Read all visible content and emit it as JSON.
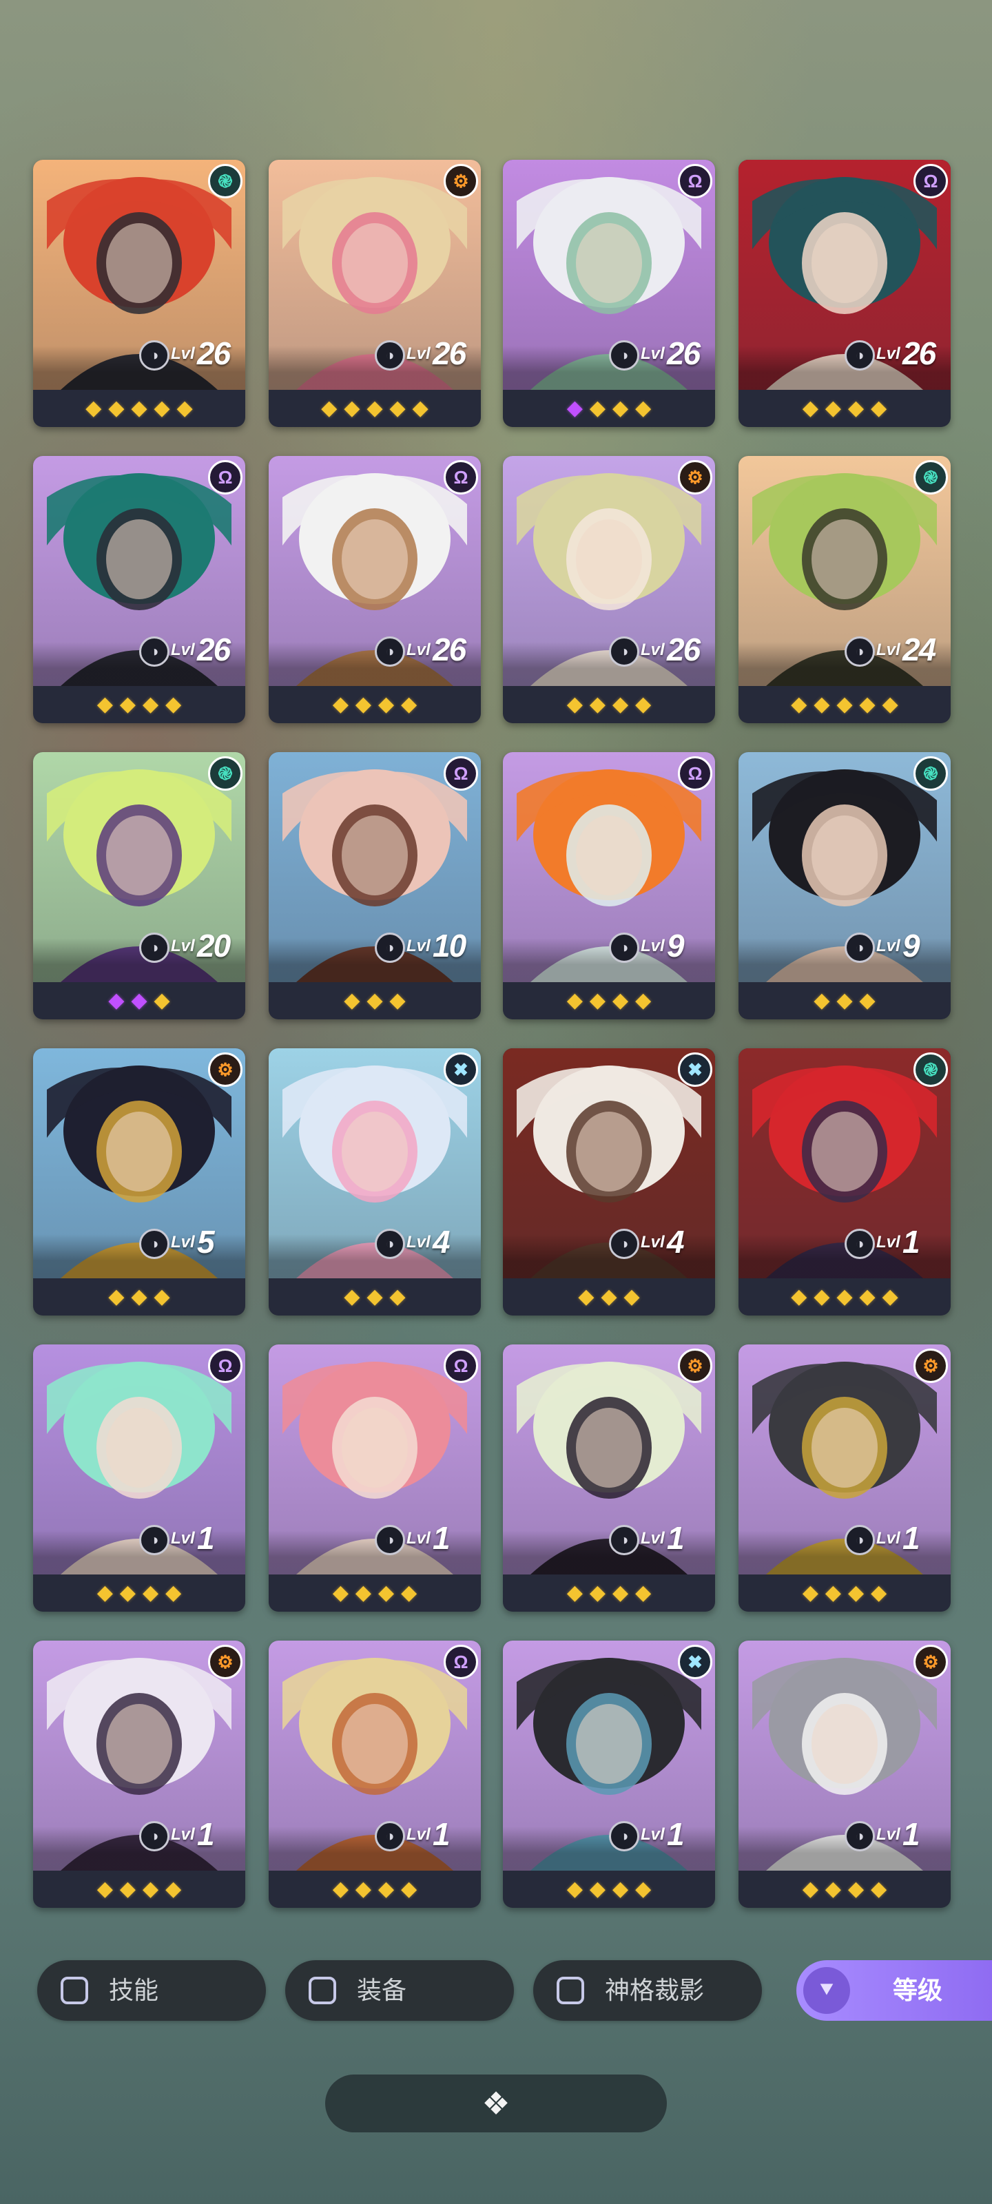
{
  "level_prefix": "Lvl",
  "heroes": [
    {
      "name": "hero-red-hair",
      "class_icon": "spiral-icon",
      "class_color": "teal",
      "level": "26",
      "stars": [
        "gold",
        "gold",
        "gold",
        "gold",
        "gold"
      ],
      "palette": [
        "#f4b37a",
        "#d9422c",
        "#2b2b33"
      ]
    },
    {
      "name": "hero-blonde-roses",
      "class_icon": "gear-icon",
      "class_color": "orange",
      "level": "26",
      "stars": [
        "gold",
        "gold",
        "gold",
        "gold",
        "gold"
      ],
      "palette": [
        "#f2bd9a",
        "#e8d2a4",
        "#e57a92"
      ]
    },
    {
      "name": "hero-white-hair",
      "class_icon": "omega-icon",
      "class_color": "purple",
      "level": "26",
      "stars": [
        "purple",
        "gold",
        "gold",
        "gold"
      ],
      "palette": [
        "#c28be2",
        "#ececf2",
        "#8dbfa5"
      ]
    },
    {
      "name": "hero-red-parasol",
      "class_icon": "omega-icon",
      "class_color": "purple",
      "level": "26",
      "stars": [
        "gold",
        "gold",
        "gold",
        "gold"
      ],
      "palette": [
        "#b5222e",
        "#23535a",
        "#f0d7c8"
      ]
    },
    {
      "name": "hero-teal-hood",
      "class_icon": "omega-icon",
      "class_color": "purple",
      "level": "26",
      "stars": [
        "gold",
        "gold",
        "gold",
        "gold"
      ],
      "palette": [
        "#c49be4",
        "#1d7a72",
        "#2a2a35"
      ]
    },
    {
      "name": "hero-curly-white",
      "class_icon": "omega-icon",
      "class_color": "purple",
      "level": "26",
      "stars": [
        "gold",
        "gold",
        "gold",
        "gold"
      ],
      "palette": [
        "#c49be4",
        "#f2f2f2",
        "#b07a4c"
      ]
    },
    {
      "name": "hero-green-bun",
      "class_icon": "gear-icon",
      "class_color": "orange",
      "level": "26",
      "stars": [
        "gold",
        "gold",
        "gold",
        "gold"
      ],
      "palette": [
        "#c4a4e8",
        "#d8d4a0",
        "#f4e6dc"
      ]
    },
    {
      "name": "hero-green-glow",
      "class_icon": "spiral-icon",
      "class_color": "teal",
      "level": "24",
      "stars": [
        "gold",
        "gold",
        "gold",
        "gold",
        "gold"
      ],
      "palette": [
        "#f2c79a",
        "#a7c85c",
        "#3a3a2a"
      ]
    },
    {
      "name": "hero-fox-ears",
      "class_icon": "spiral-icon",
      "class_color": "teal",
      "level": "20",
      "stars": [
        "purple",
        "purple",
        "gold"
      ],
      "palette": [
        "#b0d7a8",
        "#d4ec7c",
        "#5a3a7e"
      ]
    },
    {
      "name": "hero-golden-crown",
      "class_icon": "omega-icon",
      "class_color": "purple",
      "level": "10",
      "stars": [
        "gold",
        "gold",
        "gold"
      ],
      "palette": [
        "#7fb1d6",
        "#ecc4b8",
        "#6a3a2c"
      ]
    },
    {
      "name": "hero-orange-beanie",
      "class_icon": "omega-icon",
      "class_color": "purple",
      "level": "9",
      "stars": [
        "gold",
        "gold",
        "gold",
        "gold"
      ],
      "palette": [
        "#c49be4",
        "#f27b2a",
        "#dfefee"
      ]
    },
    {
      "name": "hero-black-hair",
      "class_icon": "spiral-icon",
      "class_color": "teal",
      "level": "9",
      "stars": [
        "gold",
        "gold",
        "gold"
      ],
      "palette": [
        "#8eb9d8",
        "#1c1c22",
        "#e6c8b4"
      ]
    },
    {
      "name": "hero-jackal",
      "class_icon": "gear-icon",
      "class_color": "orange",
      "level": "5",
      "stars": [
        "gold",
        "gold",
        "gold"
      ],
      "palette": [
        "#7fb7dc",
        "#1e1f30",
        "#d2a33a"
      ]
    },
    {
      "name": "hero-pastel-hair",
      "class_icon": "cross-icon",
      "class_color": "cyan",
      "level": "4",
      "stars": [
        "gold",
        "gold",
        "gold"
      ],
      "palette": [
        "#9dd2e6",
        "#dde8f6",
        "#f3a6c4"
      ]
    },
    {
      "name": "hero-white-headdress",
      "class_icon": "cross-icon",
      "class_color": "cyan",
      "level": "4",
      "stars": [
        "gold",
        "gold",
        "gold"
      ],
      "palette": [
        "#7a2a22",
        "#efe9e2",
        "#5a3a2c"
      ]
    },
    {
      "name": "hero-red-clown",
      "class_icon": "spiral-icon",
      "class_color": "teal",
      "level": "1",
      "stars": [
        "gold",
        "gold",
        "gold",
        "gold",
        "gold"
      ],
      "palette": [
        "#8c2a2a",
        "#d6262c",
        "#3a2a4a"
      ]
    },
    {
      "name": "hero-mint-hair",
      "class_icon": "omega-icon",
      "class_color": "purple",
      "level": "1",
      "stars": [
        "gold",
        "gold",
        "gold",
        "gold"
      ],
      "palette": [
        "#b690e0",
        "#8ee4cc",
        "#f2dcd2"
      ]
    },
    {
      "name": "hero-pink-hair",
      "class_icon": "omega-icon",
      "class_color": "purple",
      "level": "1",
      "stars": [
        "gold",
        "gold",
        "gold",
        "gold"
      ],
      "palette": [
        "#c49be4",
        "#ec8c9a",
        "#f4dcd2"
      ]
    },
    {
      "name": "hero-masked",
      "class_icon": "gear-icon",
      "class_color": "orange",
      "level": "1",
      "stars": [
        "gold",
        "gold",
        "gold",
        "gold"
      ],
      "palette": [
        "#c49be4",
        "#e4ecd2",
        "#2a2230"
      ]
    },
    {
      "name": "hero-anubis-armor",
      "class_icon": "gear-icon",
      "class_color": "orange",
      "level": "1",
      "stars": [
        "gold",
        "gold",
        "gold",
        "gold"
      ],
      "palette": [
        "#c49be4",
        "#3a3a40",
        "#c9a43a"
      ]
    },
    {
      "name": "hero-silver-hair",
      "class_icon": "gear-icon",
      "class_color": "orange",
      "level": "1",
      "stars": [
        "gold",
        "gold",
        "gold",
        "gold"
      ],
      "palette": [
        "#c49be4",
        "#ece6f2",
        "#3a2a44"
      ]
    },
    {
      "name": "hero-headband",
      "class_icon": "omega-icon",
      "class_color": "purple",
      "level": "1",
      "stars": [
        "gold",
        "gold",
        "gold",
        "gold"
      ],
      "palette": [
        "#c49be4",
        "#e6d29a",
        "#c26a3a"
      ]
    },
    {
      "name": "hero-bucket-hat",
      "class_icon": "cross-icon",
      "class_color": "cyan",
      "level": "1",
      "stars": [
        "gold",
        "gold",
        "gold",
        "gold"
      ],
      "palette": [
        "#c49be4",
        "#2a2a30",
        "#5a9ab4"
      ]
    },
    {
      "name": "hero-cyborg",
      "class_icon": "gear-icon",
      "class_color": "orange",
      "level": "1",
      "stars": [
        "gold",
        "gold",
        "gold",
        "gold"
      ],
      "palette": [
        "#c49be4",
        "#9a9aa4",
        "#f2f2f2"
      ]
    }
  ],
  "filters": [
    {
      "label": "技能",
      "checked": false
    },
    {
      "label": "装备",
      "checked": false
    },
    {
      "label": "神格裁影",
      "checked": false
    }
  ],
  "sort": {
    "label": "等级",
    "icon": "double-chevron-down-icon"
  },
  "bottom_toggle": {
    "icon": "collapse-icon"
  }
}
